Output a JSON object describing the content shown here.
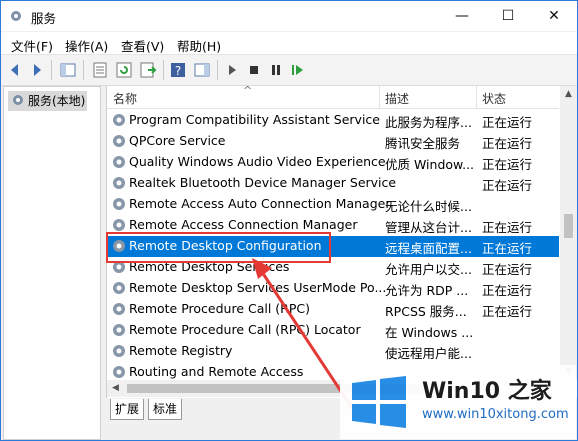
{
  "window": {
    "title": "服务",
    "min": "—",
    "max": "☐",
    "close": "✕"
  },
  "menu": [
    "文件(F)",
    "操作(A)",
    "查看(V)",
    "帮助(H)"
  ],
  "toolbar_icons": [
    "back-icon",
    "forward-icon",
    "show-console-tree-icon",
    "properties-icon",
    "refresh-icon",
    "export-icon",
    "help-icon",
    "show-action-pane-icon",
    "start-icon",
    "stop-icon",
    "pause-icon",
    "restart-icon"
  ],
  "left": {
    "item": "服务(本地)"
  },
  "columns": {
    "name": "名称",
    "desc": "描述",
    "status": "状态"
  },
  "rows": [
    {
      "name": "Program Compatibility Assistant Service",
      "desc": "此服务为程序...",
      "status": "正在运行"
    },
    {
      "name": "QPCore Service",
      "desc": "腾讯安全服务",
      "status": "正在运行"
    },
    {
      "name": "Quality Windows Audio Video Experience",
      "desc": "优质 Window...",
      "status": "正在运行"
    },
    {
      "name": "Realtek Bluetooth Device Manager Service",
      "desc": "",
      "status": "正在运行"
    },
    {
      "name": "Remote Access Auto Connection Manager",
      "desc": "无论什么时候...",
      "status": ""
    },
    {
      "name": "Remote Access Connection Manager",
      "desc": "管理从这台计...",
      "status": "正在运行"
    },
    {
      "name": "Remote Desktop Configuration",
      "desc": "远程桌面配置...",
      "status": "正在运行",
      "selected": true
    },
    {
      "name": "Remote Desktop Services",
      "desc": "允许用户以交...",
      "status": "正在运行"
    },
    {
      "name": "Remote Desktop Services UserMode Po...",
      "desc": "允许为 RDP ...",
      "status": "正在运行"
    },
    {
      "name": "Remote Procedure Call (RPC)",
      "desc": "RPCSS 服务...",
      "status": "正在运行"
    },
    {
      "name": "Remote Procedure Call (RPC) Locator",
      "desc": "在 Windows ...",
      "status": ""
    },
    {
      "name": "Remote Registry",
      "desc": "使远程用户能...",
      "status": ""
    },
    {
      "name": "Routing and Remote Access",
      "desc": "",
      "status": ""
    }
  ],
  "tabs": {
    "extended": "扩展",
    "standard": "标准"
  },
  "watermark": {
    "title": "Win10 之家",
    "url": "www.win10xitong.com"
  },
  "colors": {
    "selection": "#0078d7",
    "highlight_box": "#e53935",
    "arrow": "#e53935"
  }
}
